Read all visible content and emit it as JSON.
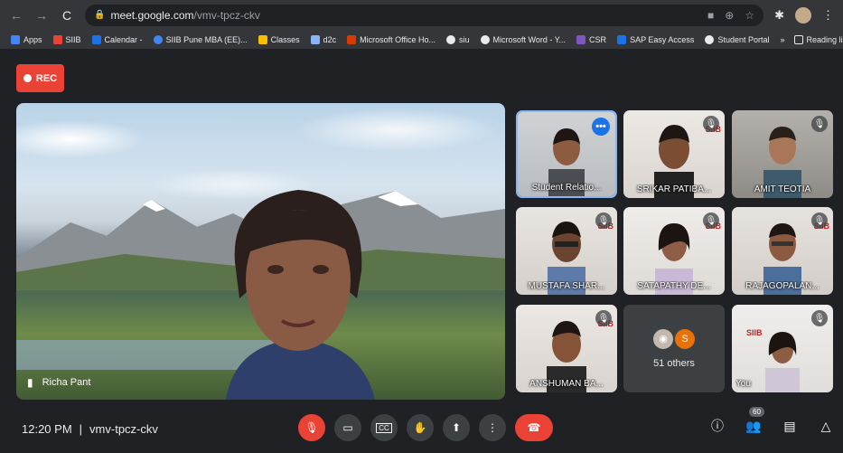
{
  "browser": {
    "url_host": "meet.google.com",
    "url_path": "/vmv-tpcz-ckv",
    "bookmarks": [
      "Apps",
      "SIIB",
      "Calendar -",
      "SIIB Pune MBA (EE)...",
      "Classes",
      "d2c",
      "Microsoft Office Ho...",
      "siu",
      "Microsoft Word - Y...",
      "CSR",
      "SAP Easy Access",
      "Student Portal"
    ],
    "overflow": "»",
    "reading_list": "Reading list"
  },
  "recording": {
    "label": "REC"
  },
  "main_tile": {
    "name": "Richa Pant"
  },
  "tiles": [
    {
      "name": "Student Relatio...",
      "badge": "more"
    },
    {
      "name": "SRIKAR PATIBA...",
      "badge": "mic-off"
    },
    {
      "name": "AMIT TEOTIA",
      "badge": "mic-off"
    },
    {
      "name": "MUSTAFA SHAR...",
      "badge": "mic-off"
    },
    {
      "name": "SATAPATHY DE...",
      "badge": "mic-off"
    },
    {
      "name": "RAJAGOPALAN...",
      "badge": "mic-off"
    },
    {
      "name": "ANSHUMAN BA...",
      "badge": "mic-off"
    },
    {
      "name": "You",
      "badge": "mic-off"
    }
  ],
  "others": {
    "label": "51 others",
    "avatar_letter": "S"
  },
  "meeting": {
    "time": "12:20 PM",
    "separator": "|",
    "code": "vmv-tpcz-ckv"
  },
  "participants_count": "60",
  "colors": {
    "rec": "#ea4335",
    "end_call": "#ea4335",
    "accent": "#1a73e8"
  }
}
